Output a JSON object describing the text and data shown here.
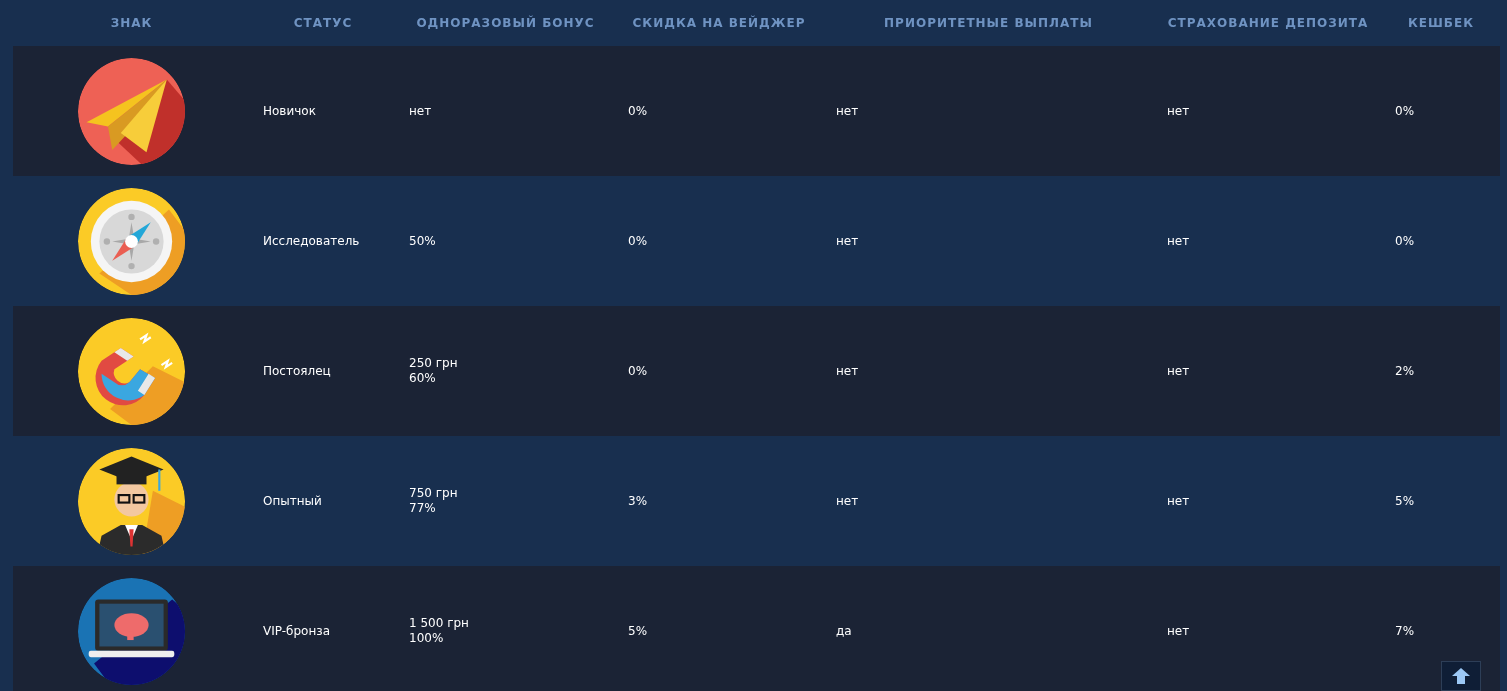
{
  "table": {
    "columns": [
      "ЗНАК",
      "СТАТУС",
      "ОДНОРАЗОВЫЙ БОНУС",
      "СКИДКА НА ВЕЙДЖЕР",
      "ПРИОРИТЕТНЫЕ ВЫПЛАТЫ",
      "СТРАХОВАНИЕ ДЕПОЗИТА",
      "КЕШБЕК"
    ],
    "rows": [
      {
        "status": "Новичок",
        "bonus": [
          "нет"
        ],
        "wager": "0%",
        "priority": "нет",
        "insurance": "нет",
        "cashback": "0%"
      },
      {
        "status": "Исследователь",
        "bonus": [
          "50%"
        ],
        "wager": "0%",
        "priority": "нет",
        "insurance": "нет",
        "cashback": "0%"
      },
      {
        "status": "Постоялец",
        "bonus": [
          "250 грн",
          "60%"
        ],
        "wager": "0%",
        "priority": "нет",
        "insurance": "нет",
        "cashback": "2%"
      },
      {
        "status": "Опытный",
        "bonus": [
          "750 грн",
          "77%"
        ],
        "wager": "3%",
        "priority": "нет",
        "insurance": "нет",
        "cashback": "5%"
      },
      {
        "status": "VIP-бронза",
        "bonus": [
          "1 500 грн",
          "100%"
        ],
        "wager": "5%",
        "priority": "да",
        "insurance": "нет",
        "cashback": "7%"
      }
    ]
  }
}
